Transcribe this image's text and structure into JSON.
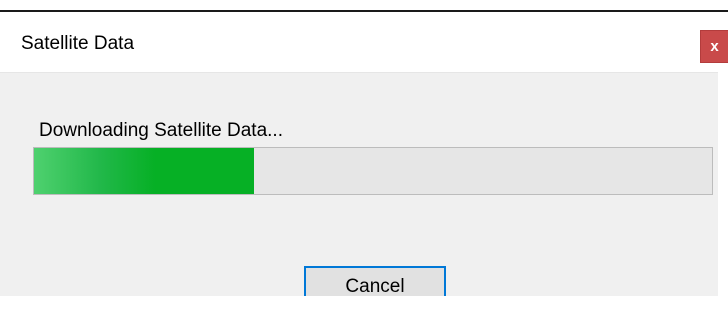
{
  "window": {
    "title": "Satellite Data",
    "close_glyph": "x"
  },
  "dialog": {
    "status_text": "Downloading Satellite Data...",
    "progress_fraction": 0.325,
    "cancel_label": "Cancel"
  },
  "colors": {
    "close_button": "#c94a4a",
    "progress_fill": "#06b025",
    "focus_border": "#0078d7"
  },
  "icons": {
    "close": "close-icon"
  }
}
